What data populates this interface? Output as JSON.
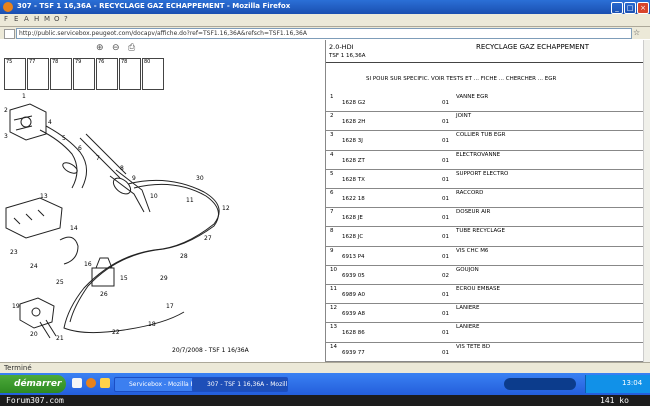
{
  "window": {
    "title": "307 - TSF 1 16,36A - RECYCLAGE GAZ ECHAPPEMENT - Mozilla Firefox",
    "buttons": [
      "_",
      "□",
      "×"
    ]
  },
  "menu": [
    "F",
    "E",
    "A",
    "H",
    "M",
    "O",
    "?"
  ],
  "address_bar": {
    "url": "http://public.servicebox.peugeot.com/docapv/affiche.do?ref=TSF1.16,36A&refsch=TSF1.16,36A"
  },
  "left_panel": {
    "zoom_icons": [
      "zoom-in-icon",
      "zoom-out-icon",
      "print-icon"
    ],
    "thumbnails": [
      {
        "label": "75"
      },
      {
        "label": "77"
      },
      {
        "label": "78"
      },
      {
        "label": "79"
      },
      {
        "label": "76"
      },
      {
        "label": "78"
      },
      {
        "label": "80"
      }
    ],
    "part_numbers": [
      "1",
      "2",
      "3",
      "4",
      "5",
      "6",
      "7",
      "8",
      "9",
      "10",
      "11",
      "12",
      "13",
      "14",
      "15",
      "16",
      "17",
      "18",
      "19",
      "20",
      "21",
      "22",
      "23",
      "24",
      "25",
      "26",
      "27",
      "28",
      "29",
      "30"
    ],
    "footer": "20/7/2008 - TSF 1 16/36A"
  },
  "right_panel": {
    "header_ref": "2.0-HDI",
    "title": "RECYCLAGE GAZ ECHAPPEMENT",
    "subref": "TSF 1 16,36A",
    "note": "SI POUR SUR SPECIFIC. VOIR TESTS ET ... FICHE ... CHERCHER ... EGR",
    "rows": [
      {
        "num": "1",
        "ref": "1628 G2",
        "qty": "01",
        "designation": "VANNE EGR"
      },
      {
        "num": "2",
        "ref": "1628 2H",
        "qty": "01",
        "designation": "JOINT"
      },
      {
        "num": "3",
        "ref": "1628 3J",
        "qty": "01",
        "designation": "COLLIER TUB EGR"
      },
      {
        "num": "4",
        "ref": "1628 ZT",
        "qty": "01",
        "designation": "ELECTROVANNE"
      },
      {
        "num": "5",
        "ref": "1628 TX",
        "qty": "01",
        "designation": "SUPPORT ELECTRO"
      },
      {
        "num": "6",
        "ref": "1622 18",
        "qty": "01",
        "designation": "RACCORD"
      },
      {
        "num": "7",
        "ref": "1628 JE",
        "qty": "01",
        "designation": "DOSEUR AIR"
      },
      {
        "num": "8",
        "ref": "1628 JC",
        "qty": "01",
        "designation": "TUBE RECYCLAGE"
      },
      {
        "num": "9",
        "ref": "6913 P4",
        "qty": "01",
        "designation": "VIS CHC M6"
      },
      {
        "num": "10",
        "ref": "6939 05",
        "qty": "02",
        "designation": "GOUJON"
      },
      {
        "num": "11",
        "ref": "6989 A0",
        "qty": "01",
        "designation": "ECROU EMBASE"
      },
      {
        "num": "12",
        "ref": "6939 A8",
        "qty": "01",
        "designation": "LANIERE"
      },
      {
        "num": "13",
        "ref": "1628 86",
        "qty": "01",
        "designation": "LANIERE"
      },
      {
        "num": "14",
        "ref": "6939 77",
        "qty": "01",
        "designation": "VIS TETE BD"
      }
    ]
  },
  "status": {
    "text": "Terminé"
  },
  "taskbar": {
    "start_label": "démarrer",
    "tasks": [
      "Servicebox - Mozilla Firefox",
      "307 - TSF 1 16,36A - Mozilla Firefox"
    ],
    "clock": "13:04"
  },
  "footer_bar": {
    "left": "Forum307.com",
    "right": "141 ko"
  }
}
